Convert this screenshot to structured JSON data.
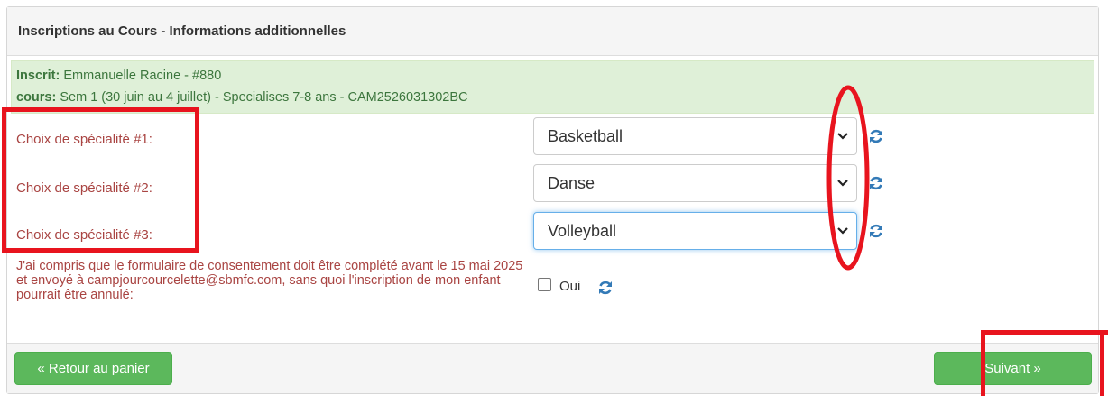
{
  "panel": {
    "title": "Inscriptions au Cours - Informations additionnelles"
  },
  "info": {
    "inscrit_label": "Inscrit:",
    "inscrit_value": " Emmanuelle Racine - #880",
    "cours_label": "cours:",
    "cours_value": " Sem 1 (30 juin au 4 juillet) - Specialises 7-8 ans - CAM2526031302BC"
  },
  "fields": [
    {
      "label": "Choix de spécialité #1:",
      "value": "Basketball"
    },
    {
      "label": "Choix de spécialité #2:",
      "value": "Danse"
    },
    {
      "label": "Choix de spécialité #3:",
      "value": "Volleyball"
    }
  ],
  "consent": {
    "text": "J'ai compris que le formulaire de consentement doit être complété avant le 15 mai 2025 et envoyé à campjourcourcelette@sbmfc.com, sans quoi l'inscription de mon enfant pourrait être annulé:",
    "option_label": "Oui",
    "checked": false
  },
  "footer": {
    "back_label": "« Retour au panier",
    "next_label": "Suivant »"
  },
  "colors": {
    "label_red": "#a94442",
    "info_green_bg": "#dff0d8",
    "button_green": "#5cb85c",
    "refresh_blue": "#337ab7",
    "annotation_red": "#e8141e"
  }
}
